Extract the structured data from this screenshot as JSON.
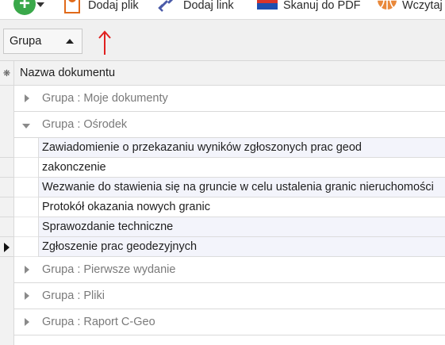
{
  "toolbar": {
    "add_file_label": "Dodaj plik",
    "add_link_label": "Dodaj link",
    "scan_label": "Skanuj do PDF",
    "load_label": "Wczytaj"
  },
  "group_panel": {
    "chip_label": "Grupa",
    "sort_direction": "ascending"
  },
  "grid": {
    "column_header": "Nazwa dokumentu",
    "groups": [
      {
        "label": "Grupa : Moje dokumenty",
        "expanded": false
      },
      {
        "label": "Grupa : Ośrodek",
        "expanded": true,
        "rows": [
          "Zawiadomienie o przekazaniu wyników zgłoszonych prac geod",
          "zakonczenie",
          "Wezwanie do stawienia się na gruncie w celu ustalenia granic nieruchomości",
          "Protokół okazania nowych granic",
          "Sprawozdanie techniczne",
          "Zgłoszenie prac geodezyjnych"
        ],
        "current_row_index": 5
      },
      {
        "label": "Grupa : Pierwsze wydanie",
        "expanded": false
      },
      {
        "label": "Grupa : Pliki",
        "expanded": false
      },
      {
        "label": "Grupa : Raport C-Geo",
        "expanded": false
      }
    ]
  },
  "colors": {
    "accent_green": "#3aa84a",
    "arrow_red": "#e0201f",
    "group_text": "#7a7a7a",
    "row_highlight": "#f3f4fb"
  }
}
